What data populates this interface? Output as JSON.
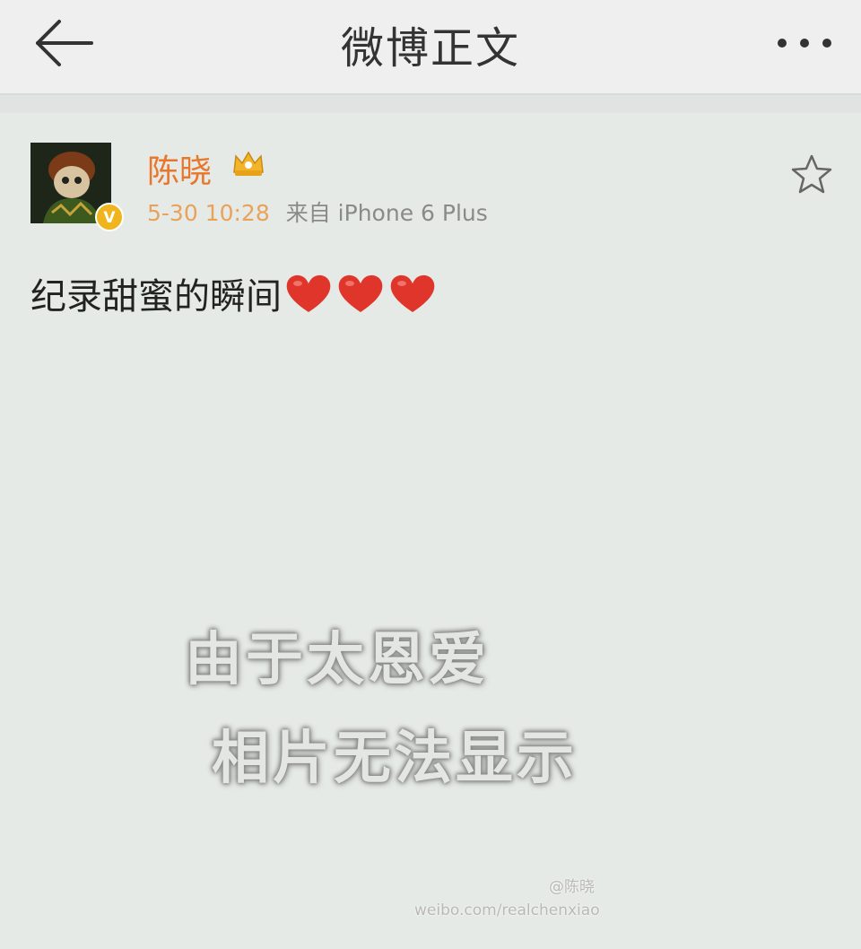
{
  "nav": {
    "title": "微博正文",
    "back_icon": "back-arrow-icon",
    "more_icon": "more-dots-icon"
  },
  "post": {
    "username": "陈晓",
    "time": "5-30 10:28",
    "source": "来自 iPhone 6 Plus",
    "text": "纪录甜蜜的瞬间",
    "heart_count": 3,
    "verified": true,
    "colors": {
      "username": "#e8772c",
      "heart": "#e0352b",
      "verified_badge": "#f0b41c"
    }
  },
  "overlay": {
    "line1": "由于太恩爱",
    "line2": "相片无法显示"
  },
  "watermark": {
    "name": "@陈晓",
    "url": "weibo.com/realchenxiao"
  }
}
